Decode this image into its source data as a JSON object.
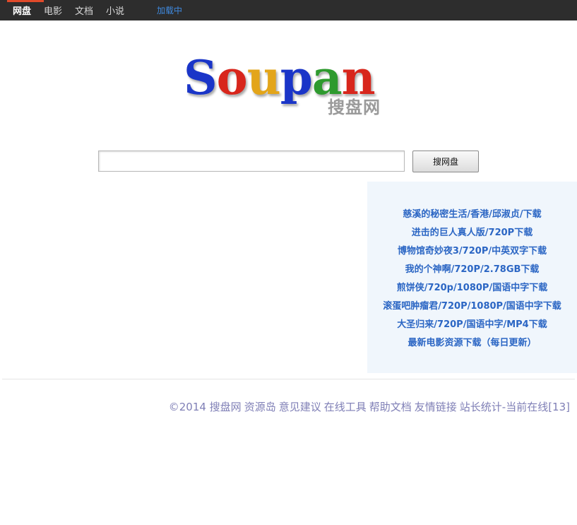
{
  "nav": {
    "items": [
      "网盘",
      "电影",
      "文档",
      "小说"
    ],
    "loading": "加载中"
  },
  "logo": {
    "letters": [
      {
        "ch": "S",
        "color": "#1a35c8"
      },
      {
        "ch": "o",
        "color": "#d8261c"
      },
      {
        "ch": "u",
        "color": "#e3a51a"
      },
      {
        "ch": "p",
        "color": "#1a35c8"
      },
      {
        "ch": "a",
        "color": "#2e9a2e"
      },
      {
        "ch": "n",
        "color": "#d8261c"
      }
    ],
    "word": "Soupan",
    "subtitle": "搜盘网"
  },
  "search": {
    "value": "",
    "placeholder": "",
    "button": "搜网盘"
  },
  "links": [
    "慈溪的秘密生活/香港/邱淑贞/下载",
    "进击的巨人真人版/720P下载",
    "博物馆奇妙夜3/720P/中英双字下载",
    "我的个神啊/720P/2.78GB下载",
    "煎饼侠/720p/1080P/国语中字下载",
    "滚蛋吧肿瘤君/720P/1080P/国语中字下载",
    "大圣归来/720P/国语中字/MP4下载",
    "最新电影资源下载（每日更新）"
  ],
  "footer": {
    "copyright": "©2014 搜盘网",
    "links": [
      "资源岛",
      "意见建议",
      "在线工具",
      "帮助文档",
      "友情链接",
      "站长统计"
    ],
    "online": "-当前在线[13]"
  },
  "colors": {
    "topbar": "#2d2d2d",
    "accent": "#e04a2a",
    "link": "#2b66c4",
    "footer": "#7f7fb6",
    "panel": "#f0f6fc"
  }
}
